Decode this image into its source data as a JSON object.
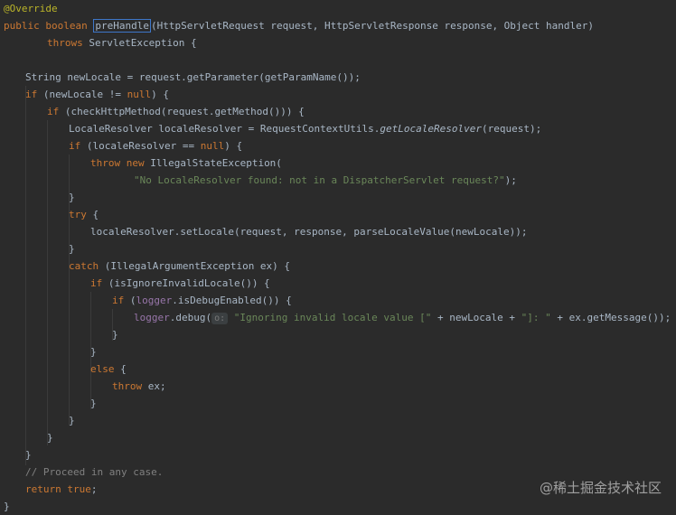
{
  "code": {
    "l1": {
      "annotation": "@Override"
    },
    "l2": {
      "kw1": "public ",
      "kw2": "boolean ",
      "method": "preHandle",
      "rest": "(HttpServletRequest request, HttpServletResponse response, Object handler)"
    },
    "l3": {
      "kw": "throws ",
      "rest": "ServletException {"
    },
    "l5": {
      "text": "String newLocale = request.getParameter(getParamName());"
    },
    "l6": {
      "kw": "if ",
      "a": "(newLocale != ",
      "kw2": "null",
      "b": ") {"
    },
    "l7": {
      "kw": "if ",
      "rest": "(checkHttpMethod(request.getMethod())) {"
    },
    "l8": {
      "a": "LocaleResolver localeResolver = RequestContextUtils.",
      "it": "getLocaleResolver",
      "b": "(request);"
    },
    "l9": {
      "kw": "if ",
      "a": "(localeResolver == ",
      "kw2": "null",
      "b": ") {"
    },
    "l10": {
      "kw": "throw new ",
      "rest": "IllegalStateException("
    },
    "l11": {
      "str": "\"No LocaleResolver found: not in a DispatcherServlet request?\"",
      "rest": ");"
    },
    "l12": {
      "text": "}"
    },
    "l13": {
      "kw": "try ",
      "rest": "{"
    },
    "l14": {
      "text": "localeResolver.setLocale(request, response, parseLocaleValue(newLocale));"
    },
    "l15": {
      "text": "}"
    },
    "l16": {
      "kw": "catch ",
      "rest": "(IllegalArgumentException ex) {"
    },
    "l17": {
      "kw": "if ",
      "rest": "(isIgnoreInvalidLocale()) {"
    },
    "l18": {
      "kw": "if ",
      "a": "(",
      "fld": "logger",
      "b": ".isDebugEnabled()) {"
    },
    "l19": {
      "fld": "logger",
      "a": ".debug(",
      "hint": "o:",
      "str1": "\"Ignoring invalid locale value [\"",
      "b": " + newLocale + ",
      "str2": "\"]: \"",
      "c": " + ex.getMessage());"
    },
    "l20": {
      "text": "}"
    },
    "l21": {
      "text": "}"
    },
    "l22": {
      "kw": "else ",
      "rest": "{"
    },
    "l23": {
      "kw": "throw ",
      "rest": "ex;"
    },
    "l24": {
      "text": "}"
    },
    "l25": {
      "text": "}"
    },
    "l26": {
      "text": "}"
    },
    "l27": {
      "text": "}"
    },
    "l28": {
      "cmt": "// Proceed in any case."
    },
    "l29": {
      "kw": "return ",
      "kw2": "true",
      "rest": ";"
    },
    "l30": {
      "text": "}"
    }
  },
  "watermark": "@稀土掘金技术社区",
  "colors": {
    "background": "#2b2b2b",
    "keyword": "#cc7832",
    "string": "#6a8759",
    "comment": "#808080",
    "annotation": "#bbb529",
    "field": "#9876aa"
  }
}
